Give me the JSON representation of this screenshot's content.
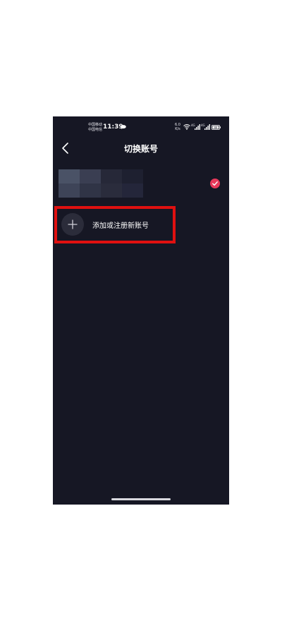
{
  "status_bar": {
    "carrier_line1": "中国移动",
    "carrier_line2": "中国电信",
    "time": "11:39",
    "net_speed_value": "6.0",
    "net_speed_unit": "K/s",
    "signal1_label": "4G",
    "signal2_label": "4G",
    "battery_level": "88"
  },
  "header": {
    "title": "切换账号"
  },
  "add_account": {
    "label": "添加或注册新账号"
  },
  "colors": {
    "background": "#161724",
    "check_accent": "#e8385a",
    "highlight": "#e01010"
  },
  "icons": {
    "back": "chevron-left-icon",
    "check": "check-circle-icon",
    "add": "plus-icon"
  }
}
